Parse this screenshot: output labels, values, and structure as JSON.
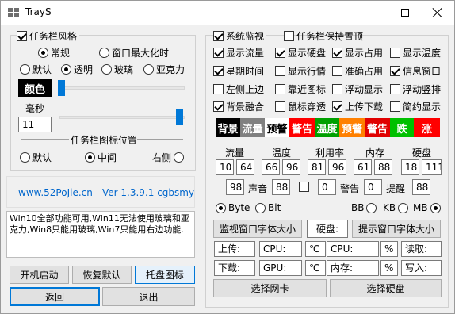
{
  "window": {
    "title": "TrayS"
  },
  "left": {
    "taskbar_style": {
      "label": "任务栏风格",
      "checked": true
    },
    "mode_normal": "常规",
    "mode_max": "窗口最大化时",
    "style_default": "默认",
    "style_transparent": "透明",
    "style_glass": "玻璃",
    "style_acrylic": "亚克力",
    "color_button": "颜色",
    "ms_label": "毫秒",
    "ms_value": "11",
    "icon_position_title": "任务栏图标位置",
    "pos_default": "默认",
    "pos_center": "中间",
    "pos_right": "右侧",
    "link_site": "www.52PoJie.cn",
    "link_version": "Ver 1.3.9.1 cgbsmy",
    "description": "Win10全部功能可用,Win11无法使用玻璃和亚克力,Win8只能用玻璃,Win7只能用右边功能.",
    "btn_autostart": "开机启动",
    "btn_restore": "恢复默认",
    "btn_tray_icon": "托盘图标",
    "btn_back": "返回",
    "btn_exit": "退出"
  },
  "right": {
    "system_monitor": "系统监视",
    "keep_top": "任务栏保持置顶",
    "options": [
      [
        "显示流量",
        "显示硬盘",
        "显示占用",
        "显示温度"
      ],
      [
        "星期时间",
        "显示行情",
        "准确占用",
        "信息窗口"
      ],
      [
        "左侧上边",
        "靠近图标",
        "浮动显示",
        "浮动竖排"
      ],
      [
        "背景融合",
        "鼠标穿透",
        "上传下载",
        "简约显示"
      ]
    ],
    "chips": {
      "bg": "背景",
      "traffic": "流量",
      "warn1": "预警",
      "alarm1": "警告",
      "temp": "温度",
      "warn2": "预警",
      "alarm2": "警告",
      "fall": "跌",
      "rise": "涨"
    },
    "colors": {
      "black": "#000000",
      "gray": "#808080",
      "white": "#ffffff",
      "red": "#ff0000",
      "green": "#00a000",
      "orange": "#ff8000",
      "red2": "#e00000",
      "green2": "#00c000",
      "red3": "#ff0000"
    },
    "headers": {
      "traffic": "流量",
      "temp": "温度",
      "usage": "利用率",
      "memory": "内存",
      "disk": "硬盘"
    },
    "values": {
      "traffic_a": "10",
      "traffic_b": "64",
      "temp_a": "66",
      "temp_b": "96",
      "usage_a": "81",
      "usage_b": "96",
      "mem_a": "61",
      "mem_b": "88",
      "disk_a": "18",
      "disk_b": "111",
      "sound_val": "98",
      "sound_label": "声音",
      "sound_b": "88",
      "alarm_val": "0",
      "alarm_label": "警告",
      "remind_val": "0",
      "remind_label": "提醒",
      "remind_b": "88"
    },
    "units": {
      "byte": "Byte",
      "bit": "Bit",
      "bb": "BB",
      "kb": "KB",
      "mb": "MB"
    },
    "btn_monitor_font": "监视窗口字体大小",
    "disk_btn": "硬盘:",
    "btn_tip_font": "提示窗口字体大小",
    "fields": {
      "upload": "上传:",
      "cpu": "CPU:",
      "celsius": "℃",
      "cpu2": "CPU:",
      "percent": "%",
      "read": "读取:",
      "download": "下载:",
      "gpu": "GPU:",
      "celsius2": "℃",
      "memory": "内存:",
      "percent2": "%",
      "write": "写入:"
    },
    "btn_select_nic": "选择网卡",
    "btn_select_disk": "选择硬盘"
  }
}
